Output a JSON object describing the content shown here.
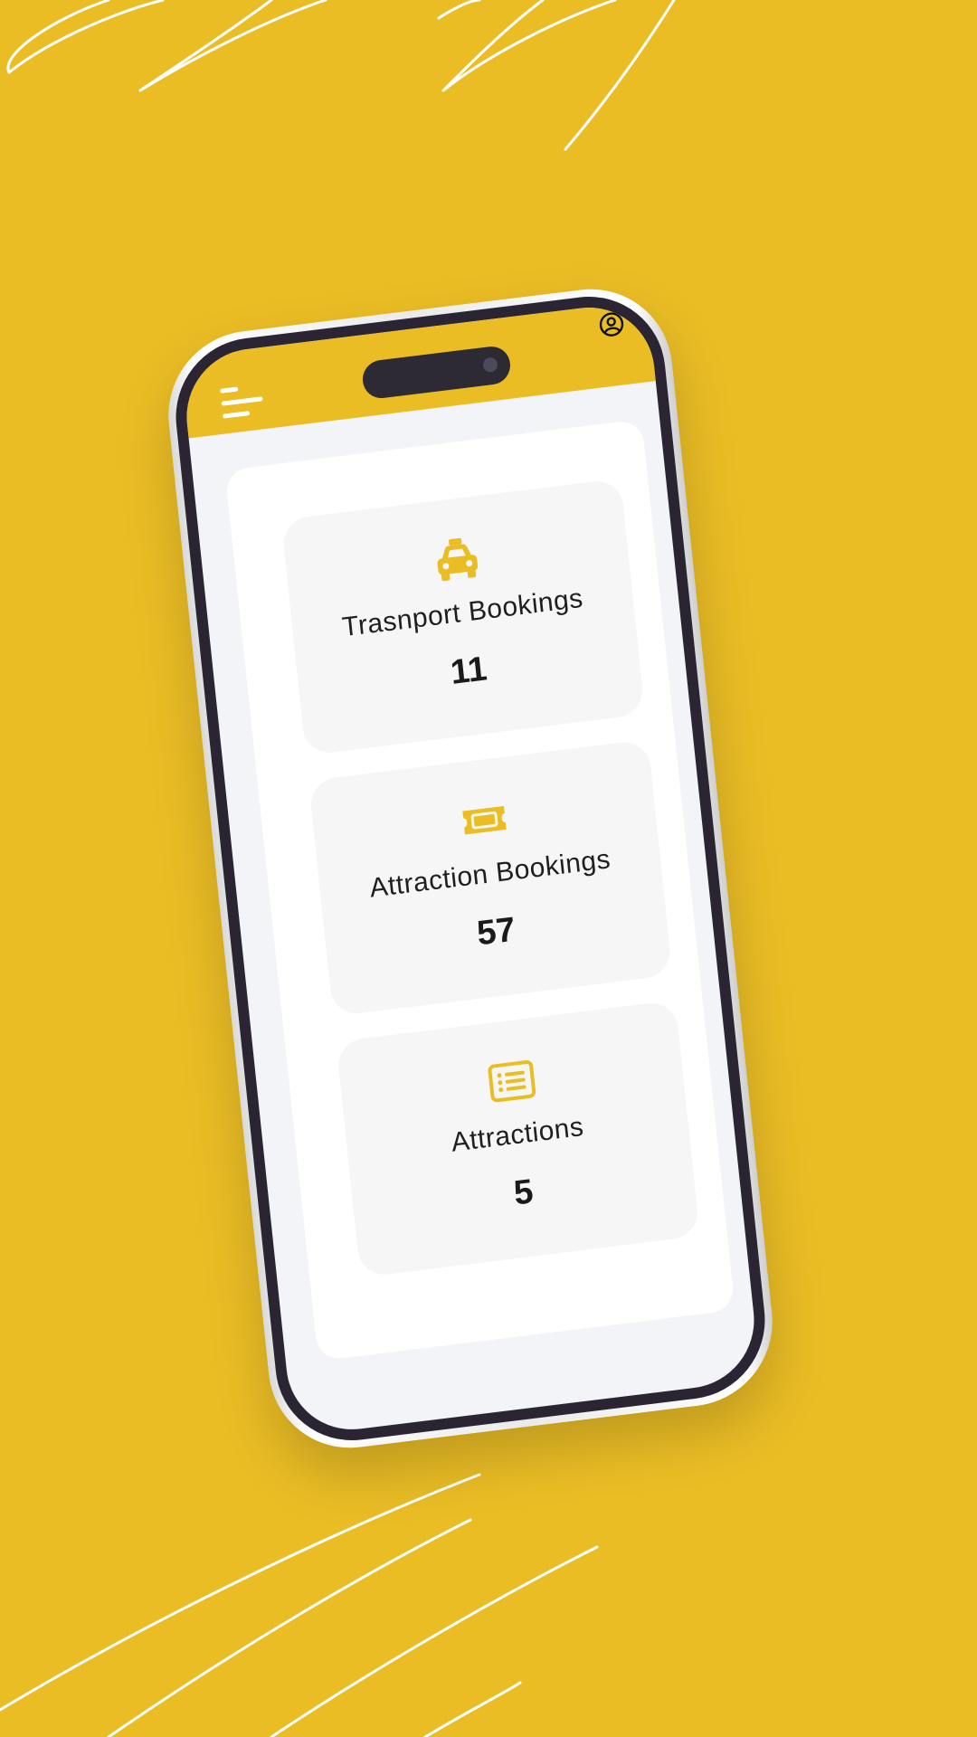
{
  "theme": {
    "background": "#EABD25",
    "accent": "#EABD25",
    "card_background": "#F6F6F6",
    "text": "#1F1F1F"
  },
  "header": {
    "menu_icon": "menu-icon",
    "profile_icon": "user-circle-icon"
  },
  "cards": [
    {
      "icon": "taxi-icon",
      "label": "Trasnport Bookings",
      "value": "11"
    },
    {
      "icon": "ticket-icon",
      "label": "Attraction Bookings",
      "value": "57"
    },
    {
      "icon": "list-icon",
      "label": "Attractions",
      "value": "5"
    }
  ]
}
